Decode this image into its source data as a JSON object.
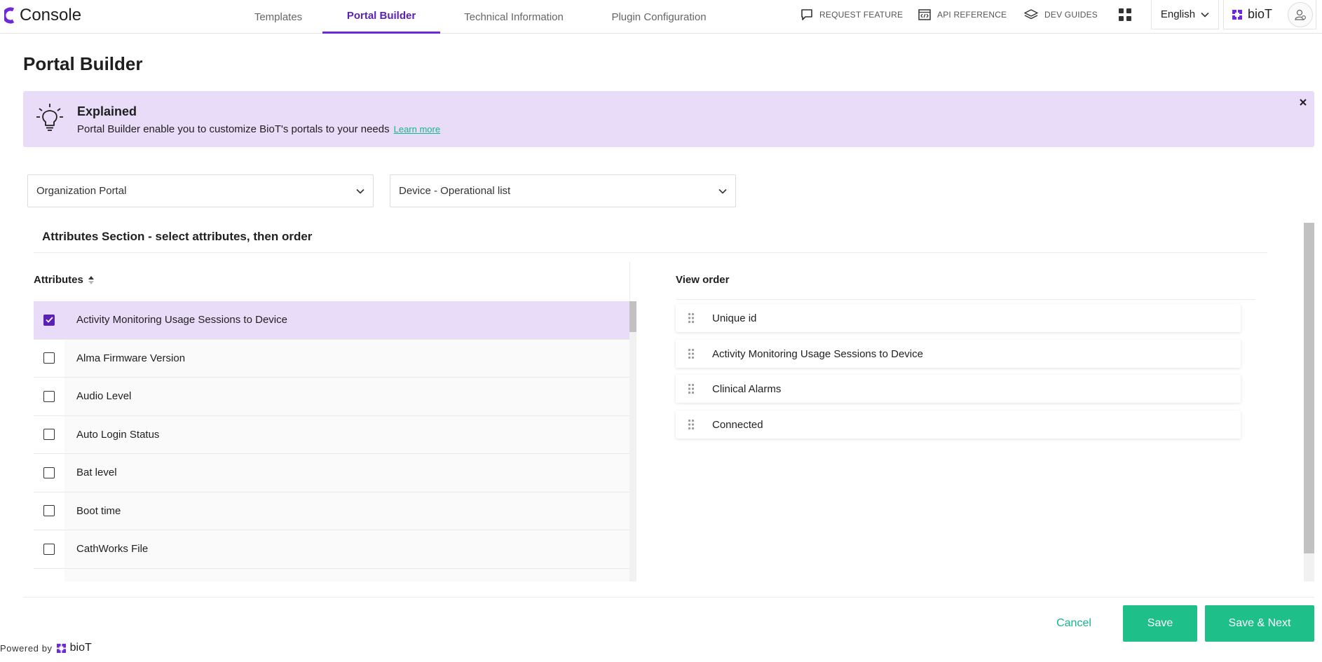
{
  "app": {
    "name": "Console",
    "accent": "#6d28d9",
    "brand_icon": "console-logo-icon"
  },
  "nav": {
    "tabs": [
      {
        "label": "Templates",
        "active": false
      },
      {
        "label": "Portal Builder",
        "active": true
      },
      {
        "label": "Technical Information",
        "active": false
      },
      {
        "label": "Plugin Configuration",
        "active": false
      }
    ],
    "links": [
      {
        "label": "REQUEST FEATURE",
        "icon": "chat-bubble-icon"
      },
      {
        "label": "API REFERENCE",
        "icon": "code-window-icon"
      },
      {
        "label": "DEV GUIDES",
        "icon": "stacked-layers-icon"
      }
    ],
    "apps_icon": "app-grid-icon",
    "language": "English",
    "organization": "bioT"
  },
  "page": {
    "title": "Portal Builder"
  },
  "banner": {
    "title": "Explained",
    "text": "Portal Builder enable you to customize BioT's portals to your needs",
    "link": "Learn more",
    "bg_color": "#e8dcf8"
  },
  "filters": {
    "portal": "Organization Portal",
    "view": "Device - Operational list"
  },
  "attributes_section": {
    "title": "Attributes Section - select attributes, then order",
    "list_header": "Attributes",
    "items": [
      {
        "label": "Activity Monitoring Usage Sessions to Device",
        "checked": true
      },
      {
        "label": "Alma Firmware Version",
        "checked": false
      },
      {
        "label": "Audio Level",
        "checked": false
      },
      {
        "label": "Auto Login Status",
        "checked": false
      },
      {
        "label": "Bat level",
        "checked": false
      },
      {
        "label": "Boot time",
        "checked": false
      },
      {
        "label": "CathWorks File",
        "checked": false
      }
    ],
    "view_order_header": "View order",
    "view_order": [
      "Unique id",
      "Activity Monitoring Usage Sessions to Device",
      "Clinical Alarms",
      "Connected"
    ]
  },
  "actions": {
    "cancel": "Cancel",
    "save": "Save",
    "save_next": "Save & Next",
    "button_color": "#1fbf8a"
  },
  "footer": {
    "powered_by": "Powered by",
    "brand": "bioT"
  }
}
